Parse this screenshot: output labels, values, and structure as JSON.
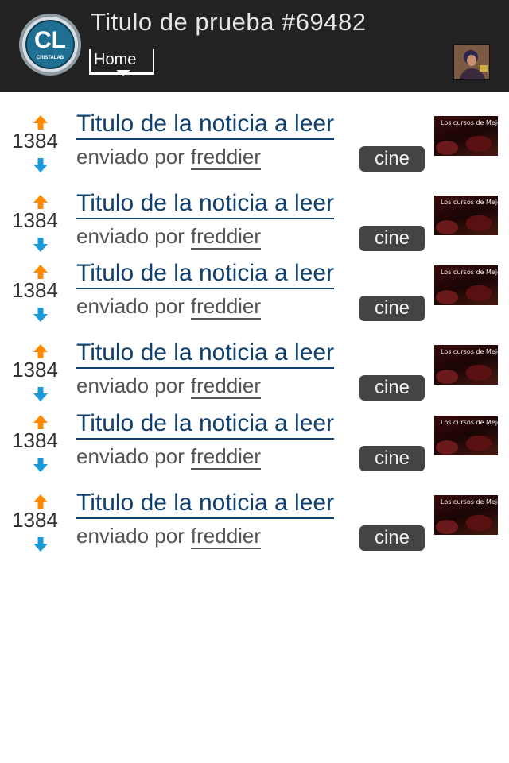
{
  "header": {
    "title": "Titulo de prueba #69482",
    "logo_text": "CL",
    "logo_subtext": "CRISTALAB",
    "nav": {
      "selected": "Home"
    }
  },
  "colors": {
    "header_bg": "#222222",
    "title_link": "#10406e",
    "vote_up": "#ff8a00",
    "vote_down": "#1a9ad8",
    "tag_bg": "#444444"
  },
  "icons": {
    "vote_up": "arrow-up-icon",
    "vote_down": "arrow-down-icon",
    "nav": "chevron-down-icon"
  },
  "news": [
    {
      "votes": "1384",
      "title": "Titulo de la noticia a leer",
      "sent_by": "enviado por",
      "author": "freddier",
      "tag": "cine",
      "thumb_text": "Los cursos de Mejorando.la"
    },
    {
      "votes": "1384",
      "title": "Titulo de la noticia a leer",
      "sent_by": "enviado por",
      "author": "freddier",
      "tag": "cine",
      "thumb_text": "Los cursos de Mejorando.la"
    },
    {
      "votes": "1384",
      "title": "Titulo de la noticia a leer",
      "sent_by": "enviado por",
      "author": "freddier",
      "tag": "cine",
      "thumb_text": "Los cursos de Mejorando.la"
    },
    {
      "votes": "1384",
      "title": "Titulo de la noticia a leer",
      "sent_by": "enviado por",
      "author": "freddier",
      "tag": "cine",
      "thumb_text": "Los cursos de Mejorando.la"
    },
    {
      "votes": "1384",
      "title": "Titulo de la noticia a leer",
      "sent_by": "enviado por",
      "author": "freddier",
      "tag": "cine",
      "thumb_text": "Los cursos de Mejorando.la"
    },
    {
      "votes": "1384",
      "title": "Titulo de la noticia a leer",
      "sent_by": "enviado por",
      "author": "freddier",
      "tag": "cine",
      "thumb_text": "Los cursos de Mejorando.la"
    }
  ]
}
